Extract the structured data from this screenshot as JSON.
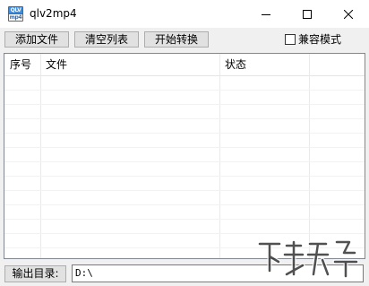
{
  "window": {
    "title": "qlv2mp4",
    "icon_text_top": "QLV",
    "icon_text_bottom": "mp4"
  },
  "toolbar": {
    "add_file": "添加文件",
    "clear_list": "清空列表",
    "start_convert": "开始转换",
    "compat_mode_label": "兼容模式",
    "compat_mode_checked": false
  },
  "table": {
    "columns": [
      "序号",
      "文件",
      "状态"
    ],
    "rows": []
  },
  "output": {
    "label": "输出目录:",
    "path": "D:\\"
  },
  "colors": {
    "window_bg": "#f0f0f0",
    "titlebar_bg": "#ffffff",
    "button_bg": "#e1e1e1",
    "button_border": "#adadad",
    "icon_blue": "#2a6fc0"
  }
}
